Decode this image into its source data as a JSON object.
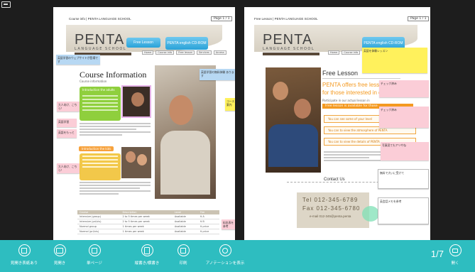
{
  "viewer": {
    "page_counter": "1/7",
    "toolbar": [
      {
        "name": "toolbar-btn-1",
        "label": "見開き表紙あり"
      },
      {
        "name": "toolbar-btn-2",
        "label": "見開き"
      },
      {
        "name": "toolbar-btn-3",
        "label": "単ページ"
      },
      {
        "name": "toolbar-btn-4",
        "label": "縦書き/横書き"
      },
      {
        "name": "toolbar-btn-5",
        "label": "印刷"
      },
      {
        "name": "toolbar-btn-6",
        "label": "アノテーションを表示"
      },
      {
        "name": "toolbar-btn-close",
        "label": "開く"
      }
    ]
  },
  "left_page": {
    "course_label": "Course info | PENTA LANGUAGE SCHOOL",
    "page_no": "Page 1 / 1",
    "logo_big": "PENTA",
    "logo_small": "LANGUAGE SCHOOL",
    "btn_free_lesson": "Free Lesson",
    "btn_english_cd": "PENTA english CD-ROM",
    "nav": [
      "Home",
      "Course info",
      "Free lesson",
      "Services",
      "Access"
    ],
    "title": "Course Information",
    "subtitle": "Course information",
    "block1_title": "Introduction the adults",
    "block2_title": "Introduction the kids",
    "table_headers": [
      "Course",
      "Description",
      "Level",
      "Fee"
    ],
    "table_rows": [
      [
        "Intensive (group)",
        "2 to 5 times per week",
        "Available",
        "¥ A"
      ],
      [
        "Intensive (pri/vis)",
        "2 to 5 times per week",
        "Available",
        "¥ B"
      ],
      [
        "Normal group",
        "1 times per week",
        "Available",
        "¥ price"
      ],
      [
        "Normal (pri/vis)",
        "1 times per week",
        "Available",
        "¥ price"
      ]
    ],
    "notes": {
      "blue_top": "英語学習のウェブサイトが登場です",
      "pink_1": "大人向け、こちら！",
      "pink_2": "英語学習",
      "pink_3": "英語をもっと",
      "pink_4": "大人向け、こちら！",
      "blue_right": "英語学習の無料体験 あります",
      "yellow_right": "コース案内",
      "pink_bottom": "料金表を参考"
    }
  },
  "right_page": {
    "course_label": "Free Lesson | PENTA LANGUAGE SCHOOL",
    "page_no": "Page 1 / 1",
    "logo_big": "PENTA",
    "logo_small": "LANGUAGE SCHOOL",
    "btn_english_cd": "PENTA english CD-ROM",
    "nav": [
      "Home",
      "Course info",
      "Free lesson",
      "Services",
      "Access"
    ],
    "title": "Free Lesson",
    "line1": "PENTA offers free lesson",
    "line2": "for those interested in our p",
    "free_intro": "Participate in our actual lesson in",
    "orange_bar": "Free lesson is available for those",
    "rows": [
      "You can see some of your level",
      "You can to view the atmosphere of PENTA",
      "You can to view the details of PENTA"
    ],
    "contact_heading": "Contact Us",
    "tel": "Tel 012-345-6789",
    "fax": "Fax 012-345-6780",
    "email": "e-mail 012-345@penta.penta",
    "notes": {
      "yellow_top": "英語を体験レッスン",
      "pink_1": "チェック済み",
      "pink_2": "チェック済み",
      "pink_3": "写真見てもアリやね",
      "white_1": "無料で大いに受けて",
      "white_2": "英会話メモを参考"
    }
  }
}
